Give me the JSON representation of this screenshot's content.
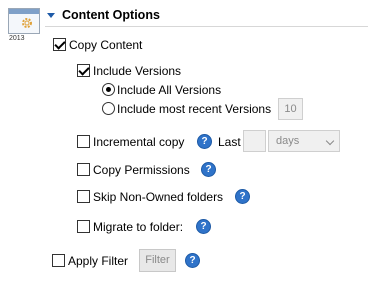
{
  "header": {
    "title": "Content Options",
    "app_year": "2013"
  },
  "options": {
    "copy_content": {
      "label": "Copy Content",
      "checked": true
    },
    "include_versions": {
      "label": "Include Versions",
      "checked": true
    },
    "include_all_versions": {
      "label": "Include All Versions",
      "selected": true
    },
    "include_recent_versions": {
      "label": "Include most recent Versions",
      "selected": false,
      "count": "10"
    },
    "incremental_copy": {
      "label": "Incremental copy",
      "checked": false,
      "last_label": "Last",
      "last_value": "",
      "unit": "days"
    },
    "copy_permissions": {
      "label": "Copy Permissions",
      "checked": false
    },
    "skip_non_owned": {
      "label": "Skip Non-Owned folders",
      "checked": false
    },
    "migrate_to_folder": {
      "label": "Migrate to folder:",
      "checked": false
    },
    "apply_filter": {
      "label": "Apply Filter",
      "checked": false,
      "button_label": "Filter"
    }
  },
  "icons": {
    "help": "help-icon",
    "gear": "gear-icon",
    "collapse": "collapse-arrow-icon"
  },
  "colors": {
    "accent": "#2f73c9",
    "header_arrow": "#1e5aa8"
  }
}
